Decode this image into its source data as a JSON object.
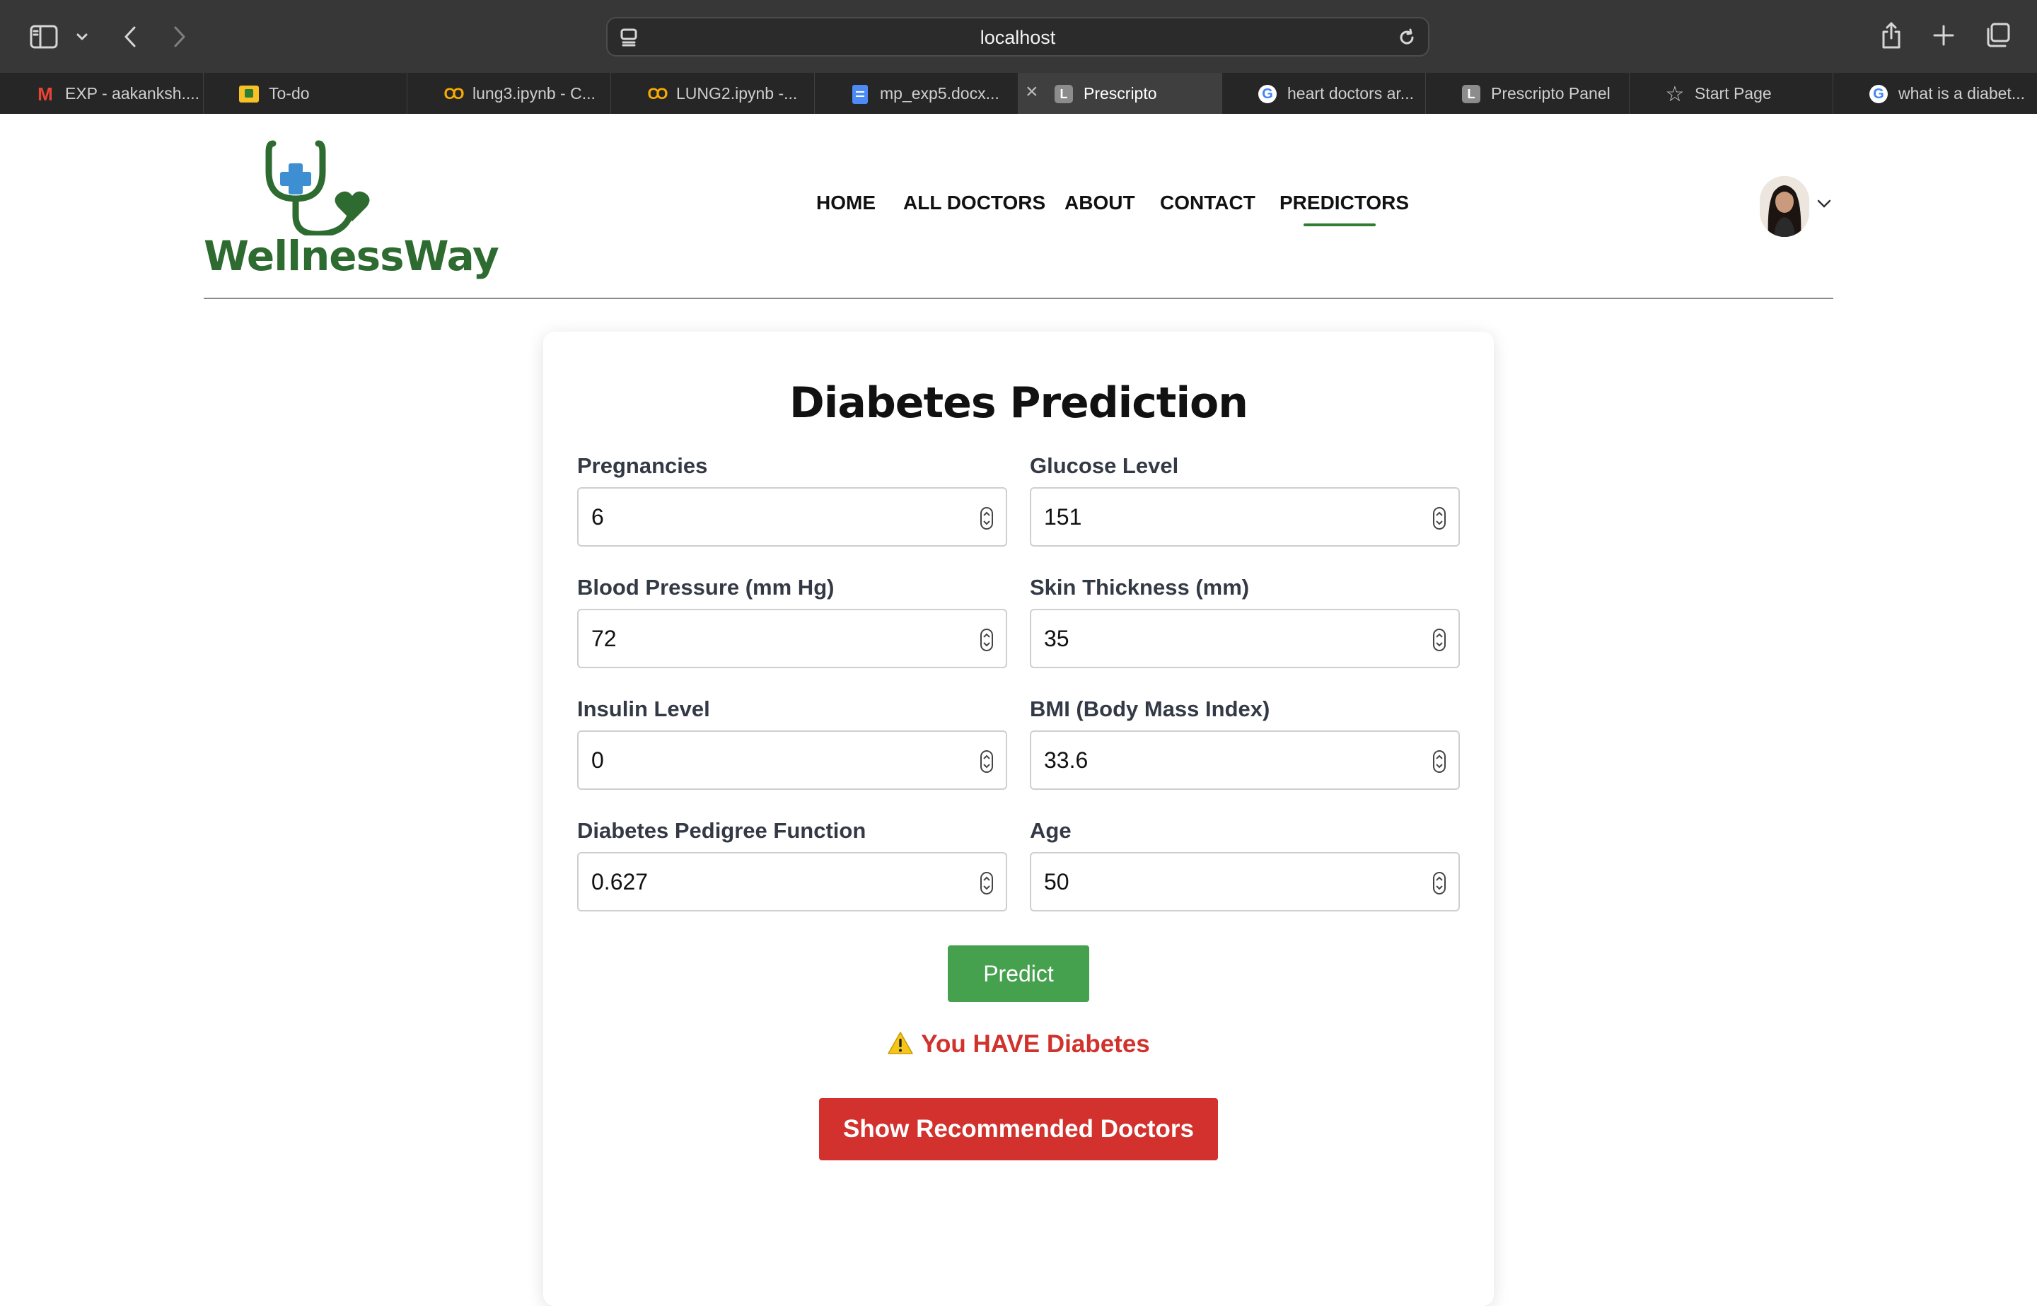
{
  "browser": {
    "url": "localhost",
    "tabs": [
      {
        "label": "EXP - aakanksh....",
        "icon": "gmail-icon"
      },
      {
        "label": "To-do",
        "icon": "todo-icon"
      },
      {
        "label": "lung3.ipynb - C...",
        "icon": "colab-icon"
      },
      {
        "label": "LUNG2.ipynb -...",
        "icon": "colab-icon"
      },
      {
        "label": "mp_exp5.docx...",
        "icon": "docs-icon"
      },
      {
        "label": "Prescripto",
        "icon": "letter-l-icon",
        "letter": "L",
        "active": true
      },
      {
        "label": "heart doctors ar...",
        "icon": "google-icon"
      },
      {
        "label": "Prescripto Panel",
        "icon": "letter-l-icon",
        "letter": "L"
      },
      {
        "label": "Start Page",
        "icon": "star-icon"
      },
      {
        "label": "what is a diabet...",
        "icon": "google-icon"
      }
    ]
  },
  "site": {
    "logo_text": "WellnessWay",
    "brand_color": "#2e6b30",
    "nav": [
      "HOME",
      "ALL DOCTORS",
      "ABOUT",
      "CONTACT",
      "PREDICTORS"
    ],
    "active_nav": "PREDICTORS"
  },
  "form": {
    "title": "Diabetes Prediction",
    "fields": [
      {
        "label": "Pregnancies",
        "value": "6"
      },
      {
        "label": "Glucose Level",
        "value": "151"
      },
      {
        "label": "Blood Pressure (mm Hg)",
        "value": "72"
      },
      {
        "label": "Skin Thickness (mm)",
        "value": "35"
      },
      {
        "label": "Insulin Level",
        "value": "0"
      },
      {
        "label": "BMI (Body Mass Index)",
        "value": "33.6"
      },
      {
        "label": "Diabetes Pedigree Function",
        "value": "0.627"
      },
      {
        "label": "Age",
        "value": "50"
      }
    ],
    "predict_label": "Predict",
    "predict_color": "#45a14d",
    "result_text": "You HAVE Diabetes",
    "result_color": "#d0322d",
    "recommend_label": "Show Recommended Doctors",
    "recommend_color": "#d2312d"
  }
}
